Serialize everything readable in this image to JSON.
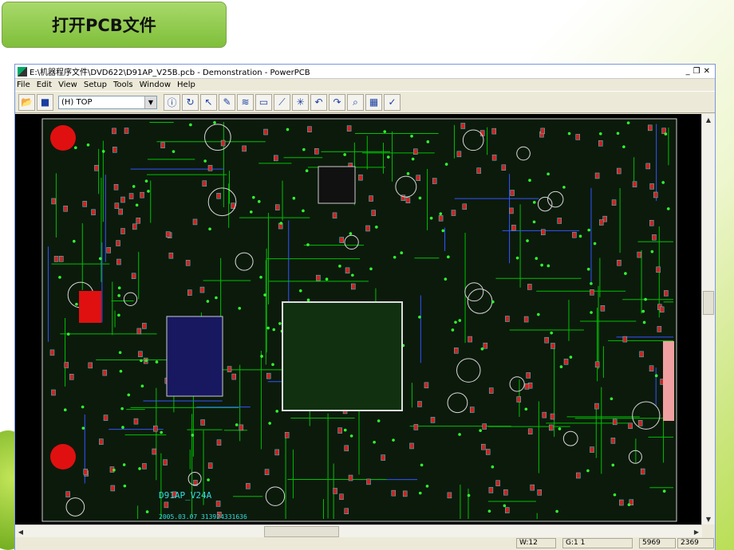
{
  "slide": {
    "title": "打开PCB文件"
  },
  "window": {
    "title": "E:\\机器程序文件\\DVD622\\D91AP_V25B.pcb - Demonstration - PowerPCB"
  },
  "menu": [
    "File",
    "Edit",
    "View",
    "Setup",
    "Tools",
    "Window",
    "Help"
  ],
  "toolbar": {
    "layer_value": "(H) TOP"
  },
  "board": {
    "label_name": "D91AP_V24A",
    "label_date": "2005.03.07 313924331636"
  },
  "status": {
    "width": "W:12",
    "grid": "G:1 1",
    "x": "5969",
    "y": "2369"
  },
  "colors": {
    "board_bg": "#000000",
    "trace": "#00c000",
    "pad": "#d42020",
    "silk": "#33dddd"
  }
}
